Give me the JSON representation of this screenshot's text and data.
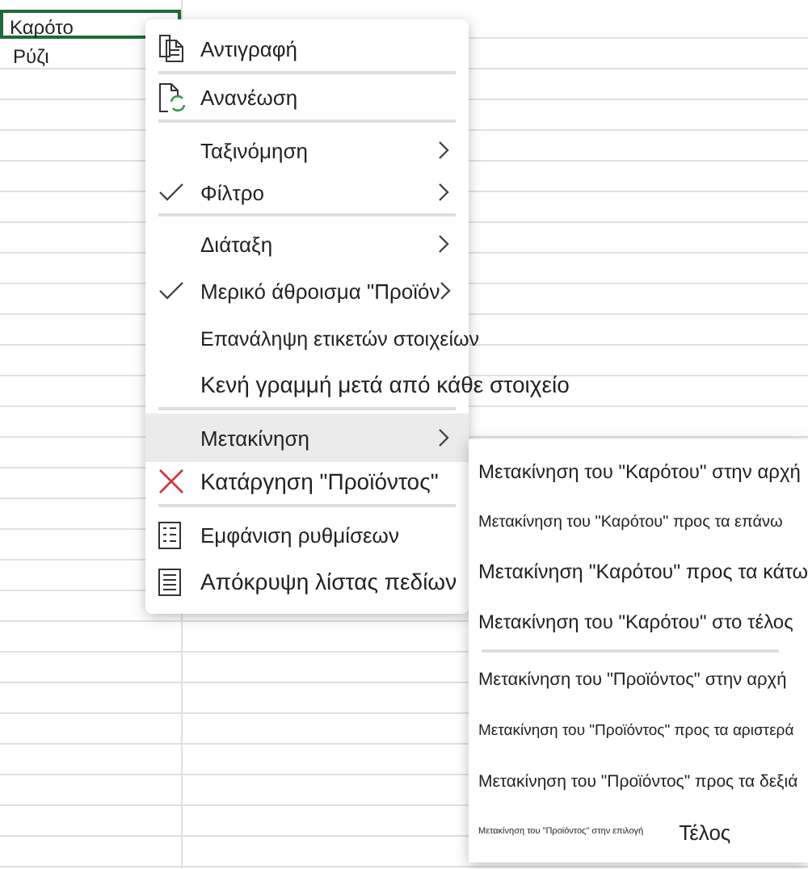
{
  "cells": [
    {
      "text": "Καρότο",
      "selected": true
    },
    {
      "text": "Ρύζι",
      "selected": false
    }
  ],
  "context_menu": {
    "items": [
      {
        "kind": "copy",
        "label": "Αντιγραφή",
        "checked": false,
        "submenu": false,
        "highlighted": false,
        "divider_after": true
      },
      {
        "kind": "refresh",
        "label": "Ανανέωση",
        "checked": false,
        "submenu": false,
        "highlighted": false,
        "divider_after": true
      },
      {
        "kind": "plain",
        "label": "Ταξινόμηση",
        "checked": false,
        "submenu": true,
        "highlighted": false,
        "divider_after": false
      },
      {
        "kind": "plain",
        "label": "Φίλτρο",
        "checked": true,
        "submenu": true,
        "highlighted": false,
        "divider_after": true
      },
      {
        "kind": "plain",
        "label": "Διάταξη",
        "checked": false,
        "submenu": true,
        "highlighted": false,
        "divider_after": false
      },
      {
        "kind": "plain",
        "label": "Μερικό άθροισμα \"Προϊόν",
        "checked": true,
        "submenu": true,
        "highlighted": false,
        "divider_after": false
      },
      {
        "kind": "plain",
        "label": "Επανάληψη ετικετών στοιχείων",
        "checked": false,
        "submenu": false,
        "highlighted": false,
        "divider_after": false
      },
      {
        "kind": "plain",
        "label": "Κενή γραμμή μετά από κάθε στοιχείο",
        "checked": false,
        "submenu": false,
        "highlighted": false,
        "divider_after": true
      },
      {
        "kind": "plain",
        "label": "Μετακίνηση",
        "checked": false,
        "submenu": true,
        "highlighted": true,
        "divider_after": false
      },
      {
        "kind": "remove",
        "label": "Κατάργηση \"Προϊόντος\"",
        "checked": false,
        "submenu": false,
        "highlighted": false,
        "divider_after": true
      },
      {
        "kind": "settings",
        "label": "Εμφάνιση ρυθμίσεων",
        "checked": false,
        "submenu": false,
        "highlighted": false,
        "divider_after": false
      },
      {
        "kind": "fieldlist",
        "label": "Απόκρυψη λίστας πεδίων",
        "checked": false,
        "submenu": false,
        "highlighted": false,
        "divider_after": false
      }
    ]
  },
  "submenu": {
    "items": [
      {
        "label": "Μετακίνηση του \"Καρότου\" στην αρχή",
        "divider_after": false
      },
      {
        "label": "Μετακίνηση του \"Καρότου\" προς τα επάνω",
        "divider_after": false
      },
      {
        "label": "Μετακίνηση \"Καρότου\" προς τα κάτω",
        "divider_after": false
      },
      {
        "label": "Μετακίνηση του \"Καρότου\" στο τέλος",
        "divider_after": true
      },
      {
        "label": "Μετακίνηση του \"Προϊόντος\" στην αρχή",
        "divider_after": false
      },
      {
        "label": "Μετακίνηση του \"Προϊόντος\" προς τα αριστερά",
        "divider_after": false
      },
      {
        "label": "Μετακίνηση του \"Προϊόντος\" προς τα δεξιά",
        "divider_after": false
      },
      {
        "label": "Μετακίνηση του \"Προϊόντος\" στην επιλογή",
        "note": "Τέλος",
        "divider_after": false
      }
    ]
  }
}
